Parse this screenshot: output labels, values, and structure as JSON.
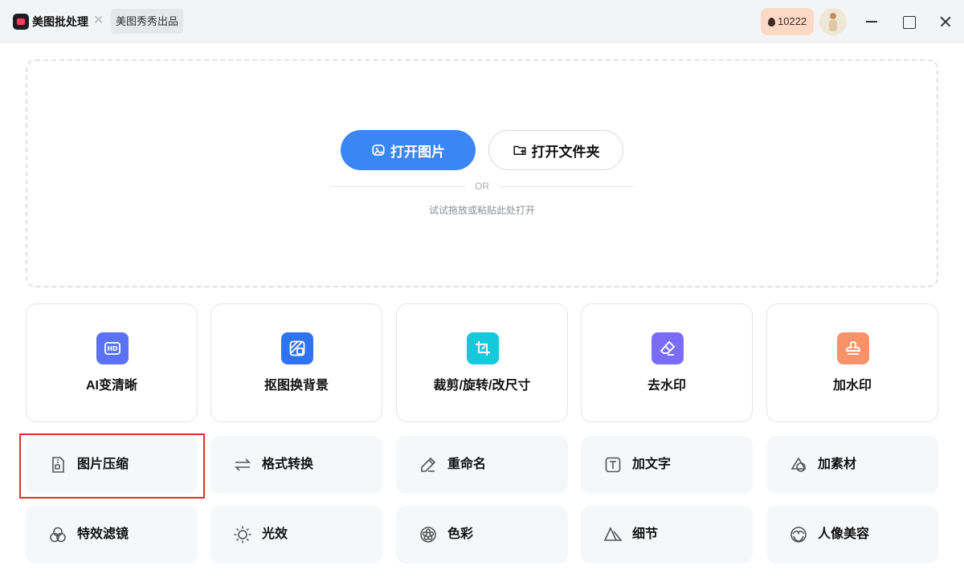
{
  "titlebar": {
    "app_name": "美图批处理",
    "brand_tag": "美图秀秀出品",
    "coins": "10222"
  },
  "dropzone": {
    "open_image": "打开图片",
    "open_folder": "打开文件夹",
    "or": "OR",
    "hint": "试试拖放或粘贴此处打开"
  },
  "features": [
    {
      "label": "AI变清晰",
      "icon": "hd-icon",
      "color": "#5b72f5"
    },
    {
      "label": "抠图换背景",
      "icon": "cutout-icon",
      "color": "#2f73f0"
    },
    {
      "label": "裁剪/旋转/改尺寸",
      "icon": "crop-icon",
      "color": "#16c8dc"
    },
    {
      "label": "去水印",
      "icon": "eraser-icon",
      "color": "#7a6cf5"
    },
    {
      "label": "加水印",
      "icon": "stamp-icon",
      "color": "#f7926b"
    }
  ],
  "tools": [
    {
      "label": "图片压缩",
      "icon": "compress-icon"
    },
    {
      "label": "格式转换",
      "icon": "swap-icon"
    },
    {
      "label": "重命名",
      "icon": "pencil-icon"
    },
    {
      "label": "加文字",
      "icon": "text-icon"
    },
    {
      "label": "加素材",
      "icon": "sticker-icon"
    },
    {
      "label": "特效滤镜",
      "icon": "filter-icon"
    },
    {
      "label": "光效",
      "icon": "sun-icon"
    },
    {
      "label": "色彩",
      "icon": "color-icon"
    },
    {
      "label": "细节",
      "icon": "detail-icon"
    },
    {
      "label": "人像美容",
      "icon": "portrait-icon"
    }
  ]
}
